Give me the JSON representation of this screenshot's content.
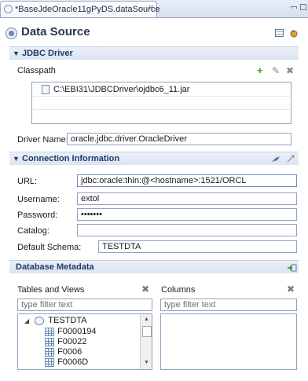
{
  "tab": {
    "title": "*BaseJdeOracle11gPyDS.dataSource",
    "close": "✕"
  },
  "header": {
    "title": "Data Source"
  },
  "jdbc": {
    "section_label": "JDBC Driver",
    "classpath_label": "Classpath",
    "add_icon": "+",
    "edit_icon": "✎",
    "remove_icon": "✖",
    "jar_path": "C:\\EBI31\\JDBCDriver\\ojdbc6_11.jar",
    "driver_name_label": "Driver Name:",
    "driver_name_value": "oracle.jdbc.driver.OracleDriver"
  },
  "connection": {
    "section_label": "Connection Information",
    "url_label": "URL:",
    "url_value": "jdbc:oracle:thin:@<hostname>:1521/ORCL",
    "username_label": "Username:",
    "username_value": "extol",
    "password_label": "Password:",
    "password_value": "•••••••",
    "catalog_label": "Catalog:",
    "catalog_value": "",
    "schema_label": "Default Schema:",
    "schema_value": "TESTDTA"
  },
  "metadata": {
    "section_label": "Database Metadata",
    "tables_label": "Tables and Views",
    "columns_label": "Columns",
    "tables_filter_placeholder": "type filter text",
    "columns_filter_placeholder": "type filter text",
    "tree_root": "TESTDTA",
    "tree_items": [
      "F0000194",
      "F00022",
      "F0006",
      "F0006D"
    ]
  }
}
